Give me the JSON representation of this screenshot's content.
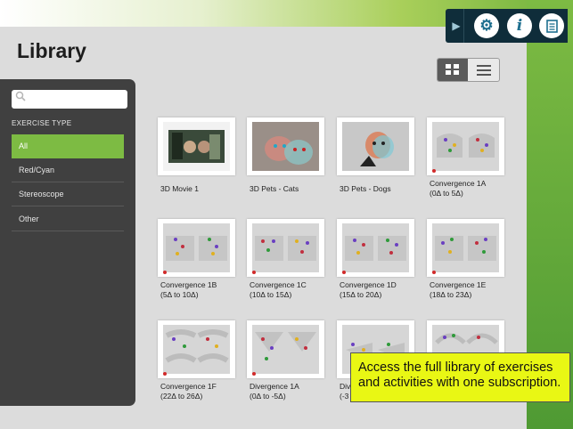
{
  "page": {
    "title": "Library"
  },
  "toolbar": {
    "collapse_icon": "chevron-right-icon",
    "settings_icon": "gear-icon",
    "info_icon": "info-icon",
    "info_glyph": "i",
    "notes_icon": "notes-icon"
  },
  "search": {
    "placeholder": "",
    "value": ""
  },
  "sidebar": {
    "section": "EXERCISE TYPE",
    "items": [
      {
        "label": "All",
        "active": true
      },
      {
        "label": "Red/Cyan",
        "active": false
      },
      {
        "label": "Stereoscope",
        "active": false
      },
      {
        "label": "Other",
        "active": false
      }
    ]
  },
  "grid": {
    "items": [
      {
        "title": "3D Movie 1",
        "thumb": "movie"
      },
      {
        "title": "3D Pets - Cats",
        "thumb": "cats"
      },
      {
        "title": "3D Pets - Dogs",
        "thumb": "dogs"
      },
      {
        "title": "Convergence 1A (0Δ to 5Δ)",
        "thumb": "exercise"
      },
      {
        "title": "Convergence 1B (5Δ to 10Δ)",
        "thumb": "exercise"
      },
      {
        "title": "Convergence 1C (10Δ to 15Δ)",
        "thumb": "exercise"
      },
      {
        "title": "Convergence 1D (15Δ to 20Δ)",
        "thumb": "exercise"
      },
      {
        "title": "Convergence 1E (18Δ to 23Δ)",
        "thumb": "exercise"
      },
      {
        "title": "Convergence 1F (22Δ to 26Δ)",
        "thumb": "exercise"
      },
      {
        "title": "Divergence 1A (0Δ to -5Δ)",
        "thumb": "exercise"
      },
      {
        "title": "Div (-3",
        "thumb": "exercise"
      },
      {
        "title": "",
        "thumb": "exercise"
      }
    ]
  },
  "promo": {
    "text": "Access the full library of exercises and activities with one subscription."
  },
  "colors": {
    "accent": "#7dbb43",
    "sidebar": "#404040",
    "toolbar": "#0f2d3a",
    "promo": "#e9f714"
  }
}
